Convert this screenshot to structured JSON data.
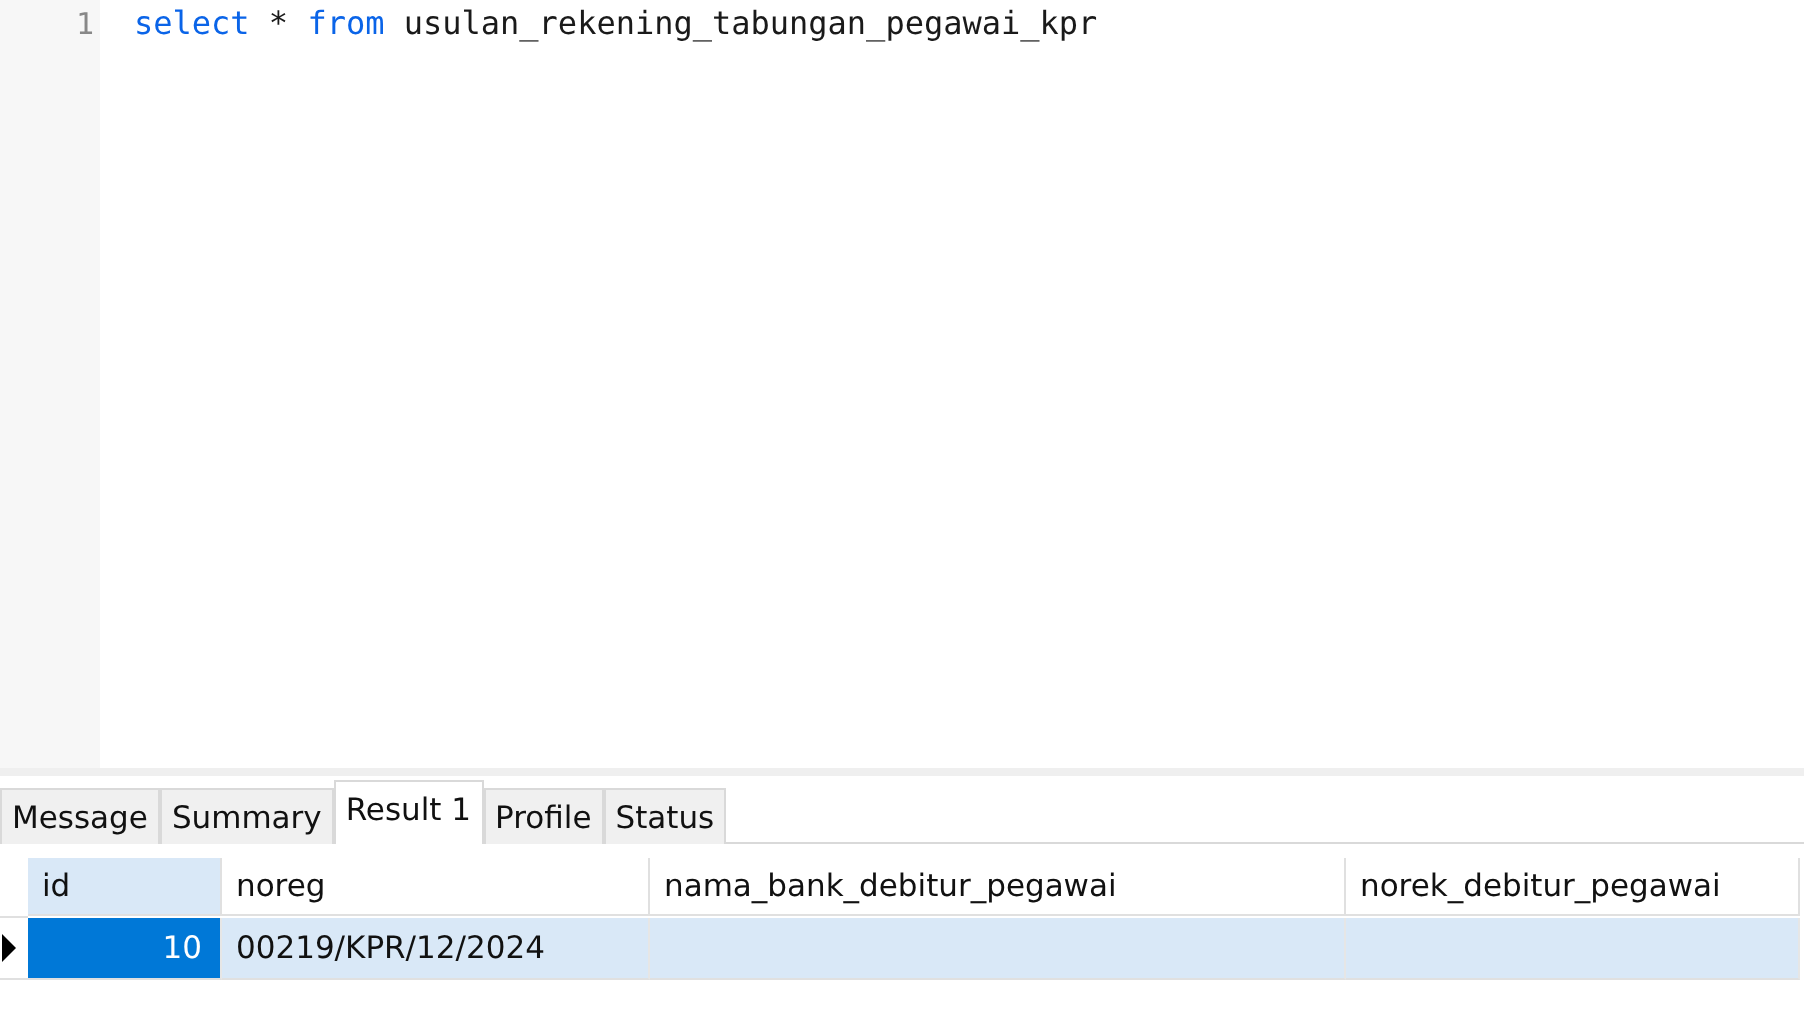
{
  "editor": {
    "lines": [
      {
        "number": "1",
        "tokens": [
          {
            "kind": "keyword",
            "text": "select"
          },
          {
            "kind": "plain",
            "text": " * "
          },
          {
            "kind": "keyword",
            "text": "from"
          },
          {
            "kind": "plain",
            "text": " usulan_rekening_tabungan_pegawai_kpr"
          }
        ]
      }
    ]
  },
  "tabs": [
    {
      "label": "Message",
      "selected": false
    },
    {
      "label": "Summary",
      "selected": false
    },
    {
      "label": "Result 1",
      "selected": true
    },
    {
      "label": "Profile",
      "selected": false
    },
    {
      "label": "Status",
      "selected": false
    }
  ],
  "grid": {
    "columns": [
      {
        "label": "id",
        "selected": true,
        "kind": "number"
      },
      {
        "label": "noreg",
        "selected": false,
        "kind": "text"
      },
      {
        "label": "nama_bank_debitur_pegawai",
        "selected": false,
        "kind": "text"
      },
      {
        "label": "norek_debitur_pegawai",
        "selected": false,
        "kind": "text"
      }
    ],
    "rows": [
      {
        "current": true,
        "cells": [
          {
            "text": "10",
            "selected": true
          },
          {
            "text": "00219/KPR/12/2024",
            "selected": false
          },
          {
            "selected": false
          },
          {
            "selected": false
          }
        ]
      }
    ]
  }
}
